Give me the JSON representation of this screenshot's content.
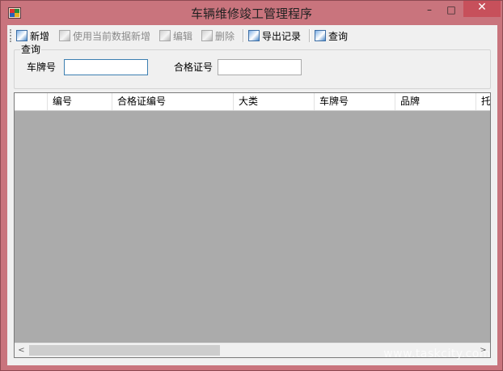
{
  "window": {
    "title": "车辆维修竣工管理程序",
    "controls": {
      "minimize": "–",
      "maximize": "□",
      "close": "✕"
    }
  },
  "toolbar": {
    "buttons": [
      {
        "label": "新增",
        "icon": "picture-icon",
        "enabled": true
      },
      {
        "label": "使用当前数据新增",
        "icon": "picture-icon",
        "enabled": false
      },
      {
        "label": "编辑",
        "icon": "picture-icon",
        "enabled": false
      },
      {
        "label": "删除",
        "icon": "picture-icon",
        "enabled": false
      },
      {
        "label": "导出记录",
        "icon": "picture-icon",
        "enabled": true
      },
      {
        "label": "查询",
        "icon": "picture-icon",
        "enabled": true
      }
    ]
  },
  "query": {
    "group_title": "查询",
    "plate_label": "车牌号",
    "plate_value": "",
    "cert_label": "合格证号",
    "cert_value": ""
  },
  "grid": {
    "columns": [
      "编号",
      "合格证编号",
      "大类",
      "车牌号",
      "品牌",
      "托"
    ]
  },
  "scrollbar": {
    "left_arrow": "<",
    "right_arrow": ">"
  },
  "watermark": "www.taskcity.com",
  "colors": {
    "title_bar": "#c9747d",
    "close_button": "#c7505b",
    "grid_background": "#ababab"
  }
}
